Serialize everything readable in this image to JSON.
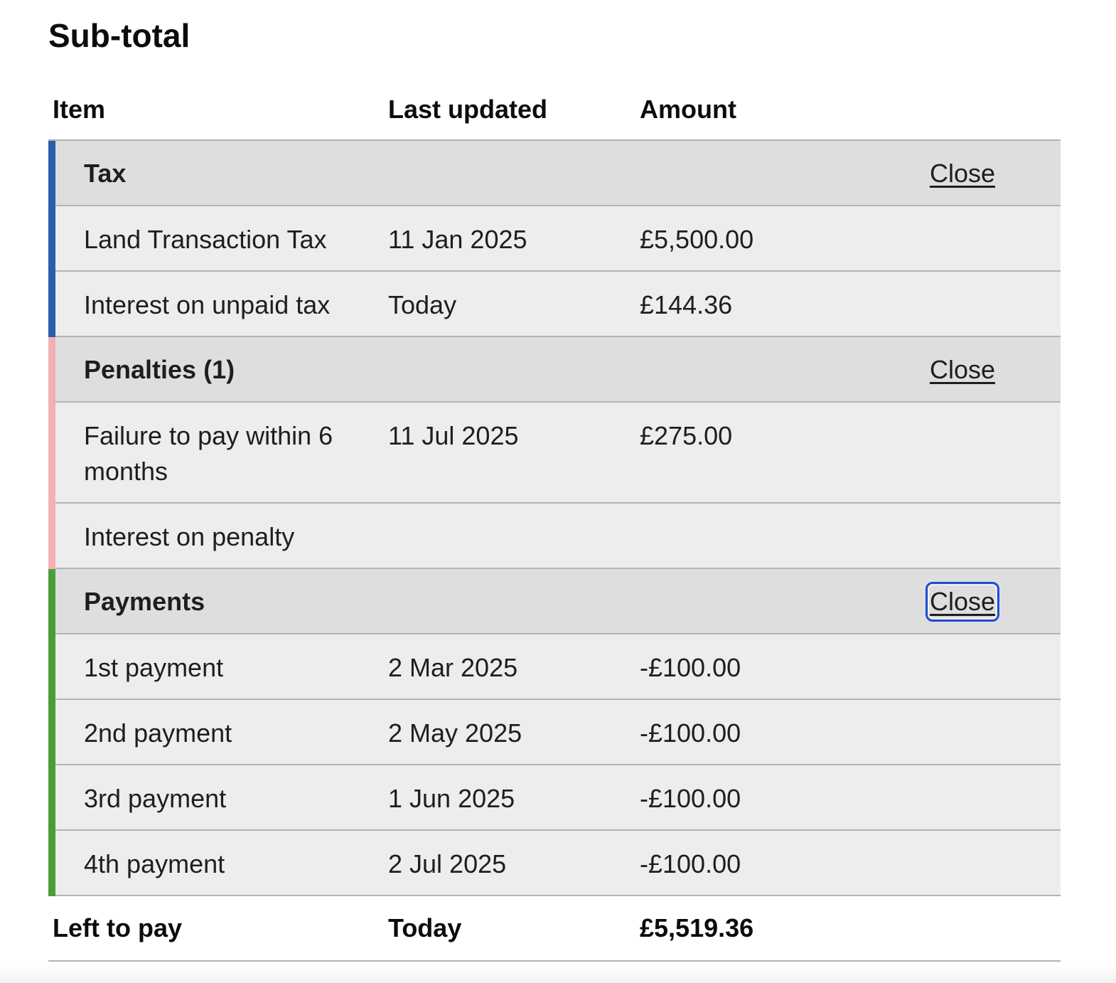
{
  "page_title": "Sub-total",
  "columns": {
    "item": "Item",
    "last_updated": "Last updated",
    "amount": "Amount"
  },
  "groups": {
    "tax": {
      "title": "Tax",
      "toggle_label": "Close",
      "accent_color": "#2a5ea8",
      "rows": [
        {
          "item": "Land Transaction Tax",
          "last_updated": "11 Jan 2025",
          "amount": "£5,500.00"
        },
        {
          "item": "Interest on unpaid tax",
          "last_updated": "Today",
          "amount": "£144.36"
        }
      ]
    },
    "penalties": {
      "title": "Penalties (1)",
      "toggle_label": "Close",
      "accent_color": "#f2b2b4",
      "rows": [
        {
          "item": "Failure to pay within 6 months",
          "last_updated": "11 Jul 2025",
          "amount": "£275.00"
        },
        {
          "item": "Interest on penalty",
          "last_updated": "",
          "amount": ""
        }
      ]
    },
    "payments": {
      "title": "Payments",
      "toggle_label": "Close",
      "accent_color": "#4a9e3a",
      "rows": [
        {
          "item": "1st payment",
          "last_updated": "2 Mar 2025",
          "amount": "-£100.00"
        },
        {
          "item": "2nd payment",
          "last_updated": "2 May 2025",
          "amount": "-£100.00"
        },
        {
          "item": "3rd payment",
          "last_updated": "1 Jun 2025",
          "amount": "-£100.00"
        },
        {
          "item": "4th payment",
          "last_updated": "2 Jul 2025",
          "amount": "-£100.00"
        }
      ]
    }
  },
  "total": {
    "label": "Left to pay",
    "last_updated": "Today",
    "amount": "£5,519.36"
  }
}
